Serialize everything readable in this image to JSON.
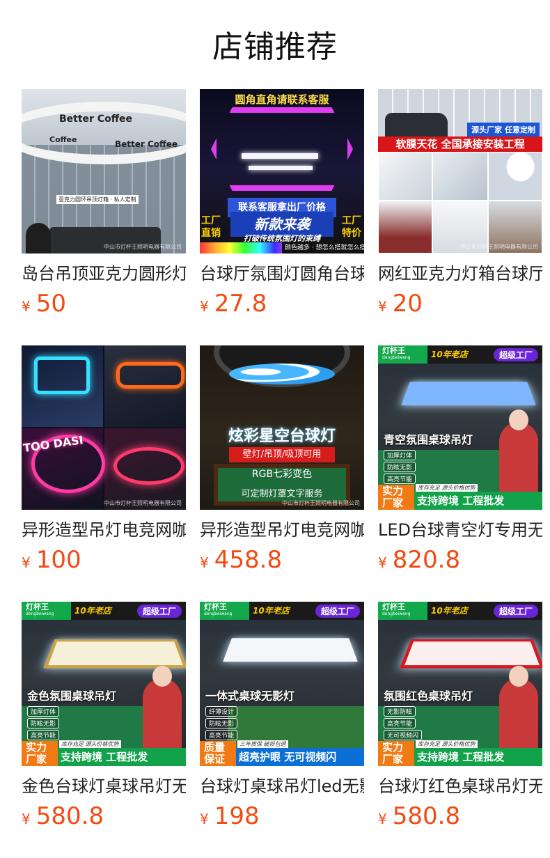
{
  "header": {
    "title": "店铺推荐"
  },
  "currency": "¥",
  "colors": {
    "price": "#f24a12"
  },
  "products": [
    {
      "title": "岛台吊顶亚克力圆形灯箱私人定制",
      "price": "50",
      "img": {
        "ring1": "Better Coffee",
        "ring2": "Better Coffee",
        "ring3": "Coffee",
        "tag": "亚克力圆环吊顶灯箱 · 私人定制",
        "wm": "中山市灯杯王照明电器有限公司"
      }
    },
    {
      "title": "台球厅氛围灯圆角台球吊灯",
      "price": "27.8",
      "img": {
        "banner": "圆角直角请联系客服",
        "blue": "联系客服拿出厂价格",
        "big": "新款来袭",
        "sub": "打破传统氛围灯的束缚",
        "left": "工厂直销",
        "right": "工厂特价",
        "strip": "颜色越多 · 想怎么搭就怎么搭"
      }
    },
    {
      "title": "网红亚克力灯箱台球厅吊顶",
      "price": "20",
      "img": {
        "src": "源头厂家 任意定制",
        "red": "软膜天花 全国承接安装工程",
        "wm": "中山市灯杯王照明电器有限公司"
      }
    },
    {
      "title": "异形造型吊灯电竞网咖吊灯",
      "price": "100",
      "img": {
        "sign": "TOO DASI",
        "wm": "中山市灯杯王照明电器有限公司"
      }
    },
    {
      "title": "异形造型吊灯电竞网咖台球灯",
      "price": "458.8",
      "img": {
        "h1": "炫彩星空台球灯",
        "r1": "壁灯/吊顶/吸顶可用",
        "r2": "RGB七彩变色",
        "r3": "可定制灯罩文字服务",
        "wm": "中山市灯杯王照明电器有限公司"
      }
    },
    {
      "title": "LED台球青空灯专用无影灯",
      "price": "820.8",
      "img": {
        "brand": "灯杯王",
        "brandsub": "dengbeiwang",
        "yr": "10年老店",
        "fac": "超级工厂",
        "ptitle": "青空氛围桌球吊灯",
        "chips": [
          "加厚灯体",
          "防眩无影",
          "高亮节能"
        ],
        "bl": "实力厂家",
        "bnote": "库存充足  源头价格优势",
        "bm": "支持跨境  工程批发"
      }
    },
    {
      "title": "金色台球灯桌球吊灯无影灯",
      "price": "580.8",
      "img": {
        "brand": "灯杯王",
        "brandsub": "dengbeiwang",
        "yr": "10年老店",
        "fac": "超级工厂",
        "ptitle": "金色氛围桌球吊灯",
        "chips": [
          "加厚灯体",
          "防眩无影",
          "高亮节能"
        ],
        "bl": "实力厂家",
        "bnote": "库存充足  源头价格优势",
        "bm": "支持跨境  工程批发"
      }
    },
    {
      "title": "台球灯桌球吊灯led无影灯",
      "price": "198",
      "img": {
        "brand": "灯杯王",
        "brandsub": "dengbeiwang",
        "yr": "10年老店",
        "fac": "超级工厂",
        "ptitle": "一体式桌球无影灯",
        "chips": [
          "纤薄设计",
          "防眩无影",
          "高亮节能"
        ],
        "bl": "质量保证",
        "bnote": "三年质保  破损包退",
        "bm": "超亮护眼 无可视频闪"
      }
    },
    {
      "title": "台球灯红色桌球吊灯无影灯",
      "price": "580.8",
      "img": {
        "brand": "灯杯王",
        "brandsub": "dengbeiwang",
        "yr": "10年老店",
        "fac": "超级工厂",
        "ptitle": "氛围红色桌球吊灯",
        "chips": [
          "无影防眩",
          "高亮节能",
          "无可视频闪"
        ],
        "bl": "实力厂家",
        "bnote": "库存充足  源头价格优势",
        "bm": "支持跨境  工程批发"
      }
    }
  ]
}
